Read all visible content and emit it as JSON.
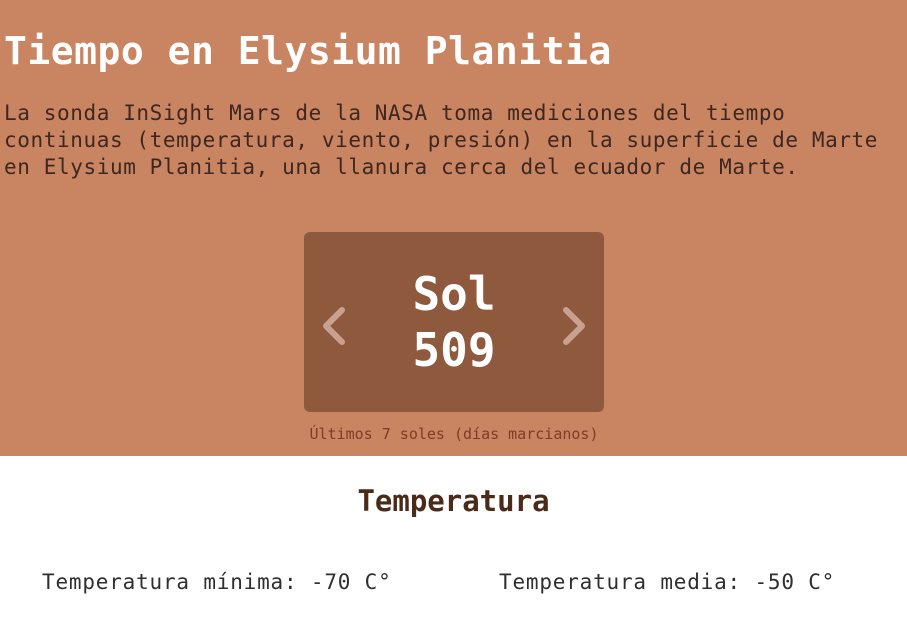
{
  "header": {
    "title": "Tiempo en Elysium Planitia",
    "description": "La sonda InSight Mars de la NASA toma mediciones del tiempo continuas (temperatura, viento, presión) en la superficie de Marte en Elysium Planitia, una llanura cerca del ecuador de Marte."
  },
  "sol_selector": {
    "label": "Sol",
    "number": "509",
    "prev_icon": "chevron-left-icon",
    "next_icon": "chevron-right-icon",
    "caption": "Últimos 7 soles (días marcianos)"
  },
  "temperature": {
    "heading": "Temperatura",
    "min_label": "Temperatura mínima:",
    "min_value": "-70 C°",
    "avg_label": "Temperatura media:",
    "avg_value": "-50 C°"
  },
  "colors": {
    "hero_background": "#c98461",
    "card_background": "#8e593d",
    "caption_text": "#7f3b29",
    "heading_text": "#4a2a18"
  }
}
